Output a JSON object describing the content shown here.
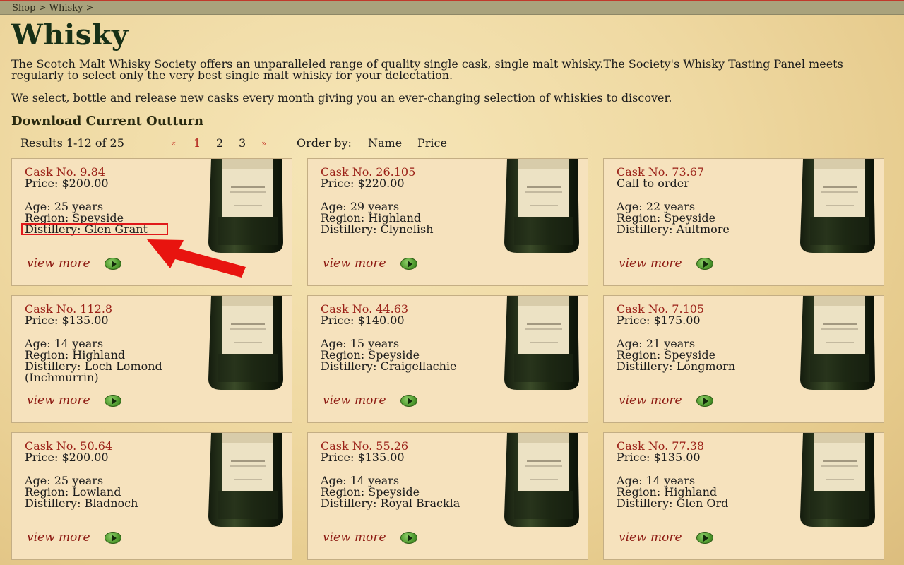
{
  "breadcrumb": [
    "Shop",
    ">",
    "Whisky",
    ">"
  ],
  "page_title": "Whisky",
  "intro": "The Scotch Malt Whisky Society offers an unparalleled range of quality single cask, single malt whisky.The Society's Whisky Tasting Panel meets regularly to select only the very best single malt whisky for your delectation.",
  "intro2": "We select, bottle and release new casks every month giving you an ever-changing selection of whiskies to discover.",
  "download_link": "Download Current Outturn",
  "toolbar": {
    "results": "Results 1-12 of 25",
    "prev_icon": "«",
    "next_icon": "»",
    "pages": [
      "1",
      "2",
      "3"
    ],
    "current_page": "1",
    "order_by_label": "Order by:",
    "order_options": [
      "Name",
      "Price"
    ]
  },
  "products": [
    {
      "cask": "Cask No. 9.84",
      "price": "Price: $200.00",
      "age": "Age: 25 years",
      "region": "Region: Speyside",
      "distillery": "Distillery: Glen Grant",
      "view_more": "view more"
    },
    {
      "cask": "Cask No. 26.105",
      "price": "Price: $220.00",
      "age": "Age: 29 years",
      "region": "Region: Highland",
      "distillery": "Distillery: Clynelish",
      "view_more": "view more"
    },
    {
      "cask": "Cask No. 73.67",
      "price": "Call to order",
      "age": "Age: 22 years",
      "region": "Region: Speyside",
      "distillery": "Distillery: Aultmore",
      "view_more": "view more"
    },
    {
      "cask": "Cask No. 112.8",
      "price": "Price: $135.00",
      "age": "Age: 14 years",
      "region": "Region: Highland",
      "distillery": "Distillery: Loch Lomond (Inchmurrin)",
      "view_more": "view more"
    },
    {
      "cask": "Cask No. 44.63",
      "price": "Price: $140.00",
      "age": "Age: 15 years",
      "region": "Region: Speyside",
      "distillery": "Distillery: Craigellachie",
      "view_more": "view more"
    },
    {
      "cask": "Cask No. 7.105",
      "price": "Price: $175.00",
      "age": "Age: 21 years",
      "region": "Region: Speyside",
      "distillery": "Distillery: Longmorn",
      "view_more": "view more"
    },
    {
      "cask": "Cask No. 50.64",
      "price": "Price: $200.00",
      "age": "Age: 25 years",
      "region": "Region: Lowland",
      "distillery": "Distillery: Bladnoch",
      "view_more": "view more"
    },
    {
      "cask": "Cask No. 55.26",
      "price": "Price: $135.00",
      "age": "Age: 14 years",
      "region": "Region: Speyside",
      "distillery": "Distillery: Royal Brackla",
      "view_more": "view more"
    },
    {
      "cask": "Cask No. 77.38",
      "price": "Price: $135.00",
      "age": "Age: 14 years",
      "region": "Region: Highland",
      "distillery": "Distillery: Glen Ord",
      "view_more": "view more"
    }
  ],
  "colors": {
    "cask_red": "#9a1f16",
    "highlight": "#e0191b",
    "card_bg": "#f6e2bd"
  }
}
